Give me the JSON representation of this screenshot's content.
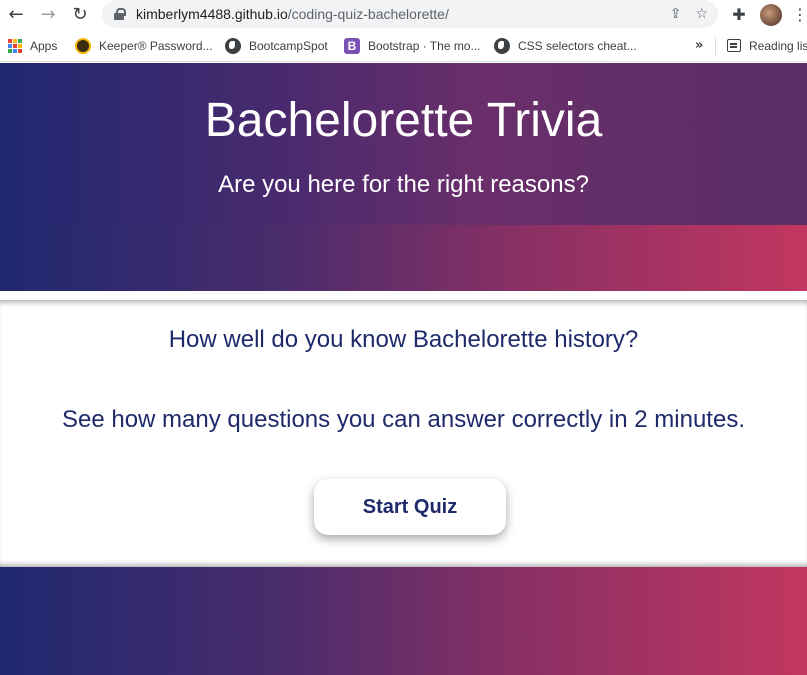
{
  "browser": {
    "url_host": "kimberlym4488.github.io",
    "url_path": "/coding-quiz-bachelorette/",
    "bookmarks": [
      {
        "label": "Apps"
      },
      {
        "label": "Keeper® Password..."
      },
      {
        "label": "BootcampSpot"
      },
      {
        "label": "Bootstrap · The mo..."
      },
      {
        "label": "CSS selectors cheat..."
      }
    ],
    "reading_list": "Reading lis"
  },
  "hero": {
    "title": "Bachelorette Trivia",
    "subtitle": "Are you here for the right reasons?"
  },
  "main": {
    "question": "How well do you know Bachelorette history?",
    "instructions": "See how many questions you can answer correctly in 2 minutes.",
    "start_label": "Start Quiz"
  },
  "colors": {
    "gradient_start": "#1f2870",
    "gradient_end": "#c23660",
    "text_primary": "#1f2a6b"
  }
}
